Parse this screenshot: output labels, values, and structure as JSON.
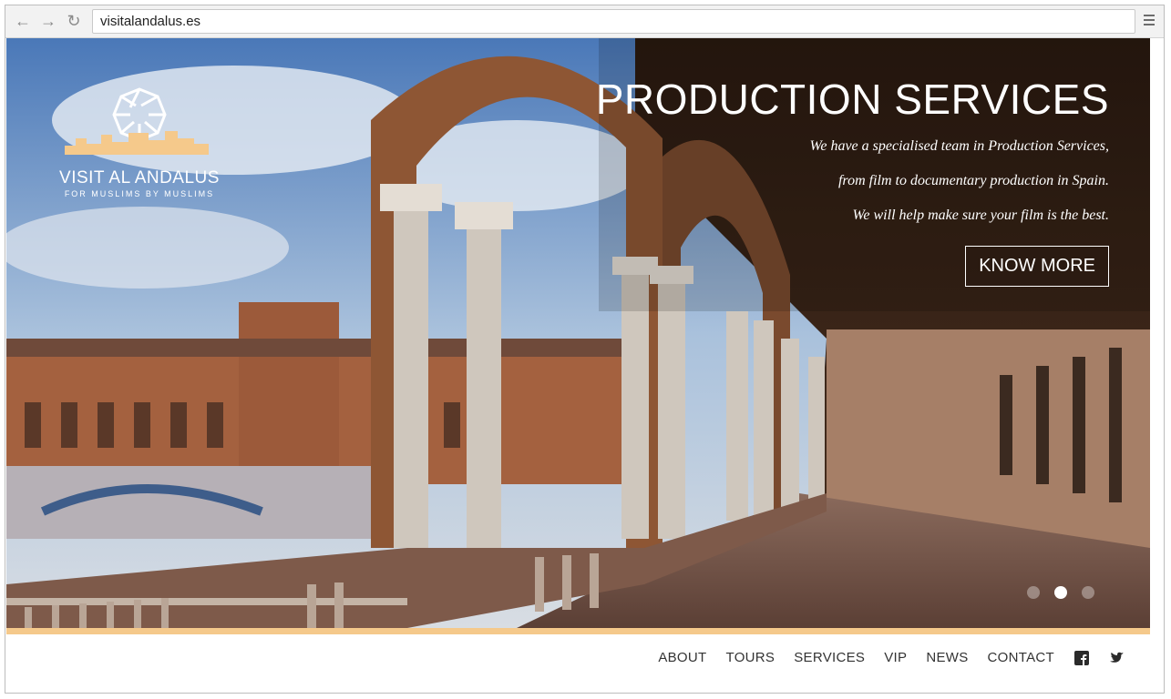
{
  "browser": {
    "url": "visitalandalus.es",
    "back_icon": "back-arrow-icon",
    "forward_icon": "forward-arrow-icon",
    "reload_icon": "reload-icon",
    "menu_icon": "hamburger-menu-icon"
  },
  "logo": {
    "title": "VISIT AL ANDALUS",
    "subtitle": "FOR MUSLIMS BY MUSLIMS"
  },
  "hero": {
    "heading": "PRODUCTION SERVICES",
    "lines": [
      "We have a specialised team in Production Services,",
      "from film to documentary production in Spain.",
      "We will help make sure your film is the best."
    ],
    "cta": "KNOW MORE",
    "slides": 3,
    "active_slide": 2
  },
  "nav": {
    "items": [
      "ABOUT",
      "TOURS",
      "SERVICES",
      "VIP",
      "NEWS",
      "CONTACT"
    ],
    "social": [
      "facebook-icon",
      "twitter-icon"
    ]
  },
  "colors": {
    "accent_strip": "#f5c98b",
    "nav_text": "#333333"
  }
}
